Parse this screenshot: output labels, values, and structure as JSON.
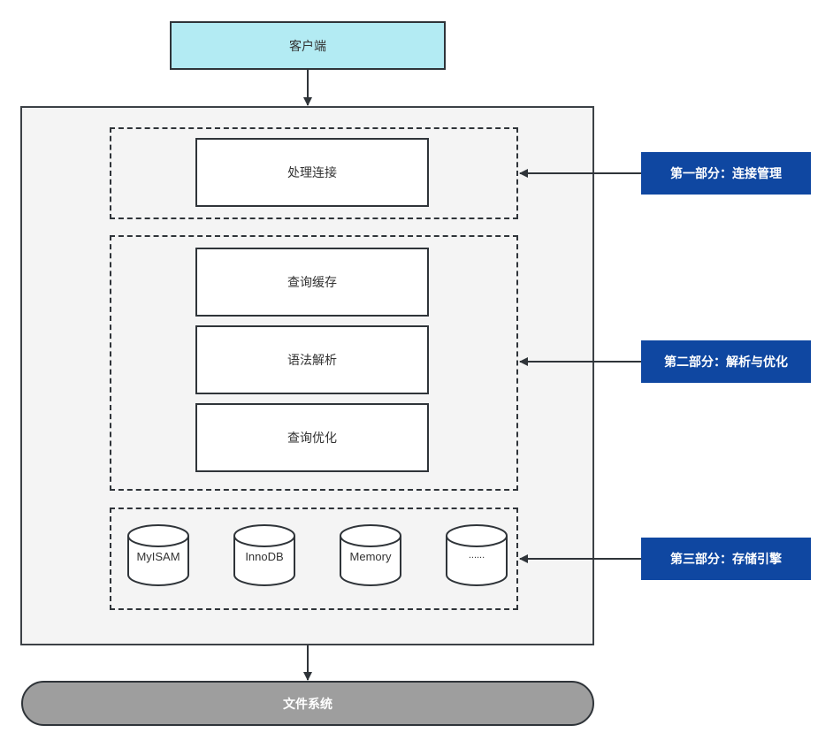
{
  "client": {
    "label": "客户端"
  },
  "server": {
    "connection_group": {
      "items": [
        {
          "label": "处理连接"
        }
      ]
    },
    "parse_group": {
      "items": [
        {
          "label": "查询缓存"
        },
        {
          "label": "语法解析"
        },
        {
          "label": "查询优化"
        }
      ]
    },
    "engine_group": {
      "engines": [
        {
          "label": "MyISAM"
        },
        {
          "label": "InnoDB"
        },
        {
          "label": "Memory"
        },
        {
          "label": "......"
        }
      ]
    }
  },
  "parts": [
    {
      "label": "第一部分：连接管理"
    },
    {
      "label": "第二部分：解析与优化"
    },
    {
      "label": "第三部分：存储引擎"
    }
  ],
  "filesystem": {
    "label": "文件系统"
  },
  "colors": {
    "client_fill": "#b3ebf3",
    "part_fill": "#0f47a1",
    "server_fill": "#f4f4f4",
    "filesystem_fill": "#9e9e9e",
    "stroke": "#2f3439"
  }
}
